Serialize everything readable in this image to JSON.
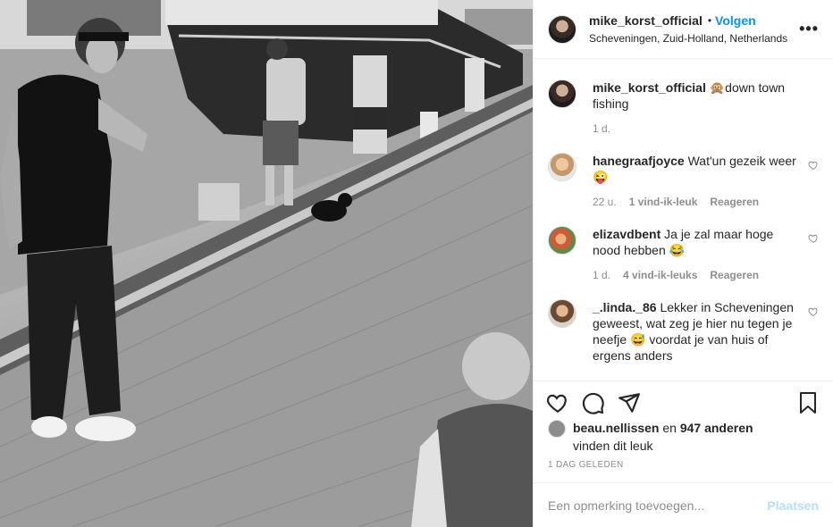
{
  "post": {
    "username": "mike_korst_official",
    "follow_label": "Volgen",
    "dot": "•",
    "location": "Scheveningen, Zuid-Holland, Netherlands",
    "more_label": "•••"
  },
  "caption": {
    "username": "mike_korst_official",
    "text": "🙊down town fishing",
    "time": "1 d."
  },
  "comments": [
    {
      "username": "hanegraafjoyce",
      "text": "Wat'un gezeik weer 😜",
      "time": "22 u.",
      "likes": "1 vind-ik-leuk",
      "reply": "Reageren"
    },
    {
      "username": "elizavdbent",
      "text": "Ja je zal maar hoge nood hebben 😂",
      "time": "1 d.",
      "likes": "4 vind-ik-leuks",
      "reply": "Reageren"
    },
    {
      "username": "_.linda._86",
      "text": "Lekker in Scheveningen geweest, wat zeg je hier nu tegen je neefje 😅 voordat je van huis of ergens anders",
      "time": "",
      "likes": "",
      "reply": ""
    }
  ],
  "likes": {
    "user": "beau.nellissen",
    "en": "en",
    "count": "947 anderen",
    "suffix": "vinden dit leuk"
  },
  "date_label": "1 DAG GELEDEN",
  "add_comment": {
    "placeholder": "Een opmerking toevoegen...",
    "post_label": "Plaatsen"
  },
  "icons": [
    "heart-icon",
    "comment-icon",
    "share-icon",
    "bookmark-icon",
    "more-icon"
  ],
  "colors": {
    "accent": "#0095f6",
    "post_disabled": "#b2dffc",
    "muted": "#8e8e8e"
  }
}
